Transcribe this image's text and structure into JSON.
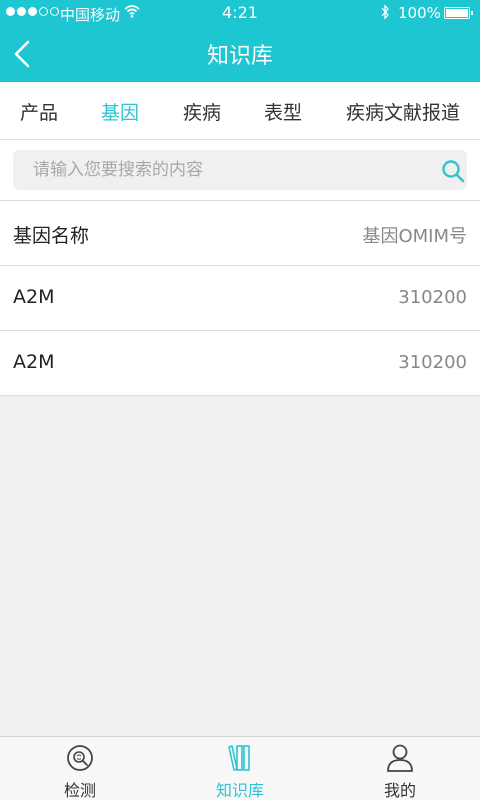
{
  "status_bar": {
    "carrier": "中国移动",
    "time": "4:21",
    "battery": "100%"
  },
  "header": {
    "title": "知识库",
    "back_icon": "chevron-left-icon"
  },
  "tabs": [
    {
      "label": "产品",
      "active": false
    },
    {
      "label": "基因",
      "active": true
    },
    {
      "label": "疾病",
      "active": false
    },
    {
      "label": "表型",
      "active": false
    },
    {
      "label": "疾病文献报道",
      "active": false
    }
  ],
  "search": {
    "value": "",
    "placeholder": "请输入您要搜索的内容",
    "icon": "search-icon"
  },
  "table": {
    "headers": {
      "name": "基因名称",
      "omim": "基因OMIM号"
    },
    "rows": [
      {
        "name": "A2M",
        "omim": "310200"
      },
      {
        "name": "A2M",
        "omim": "310200"
      }
    ]
  },
  "tabbar": [
    {
      "label": "检测",
      "icon": "detect-icon",
      "active": false
    },
    {
      "label": "知识库",
      "icon": "books-icon",
      "active": true
    },
    {
      "label": "我的",
      "icon": "user-icon",
      "active": false
    }
  ],
  "colors": {
    "header": "#1ec6d2",
    "accent": "#2fc3cf",
    "background": "#f0f0f0"
  }
}
